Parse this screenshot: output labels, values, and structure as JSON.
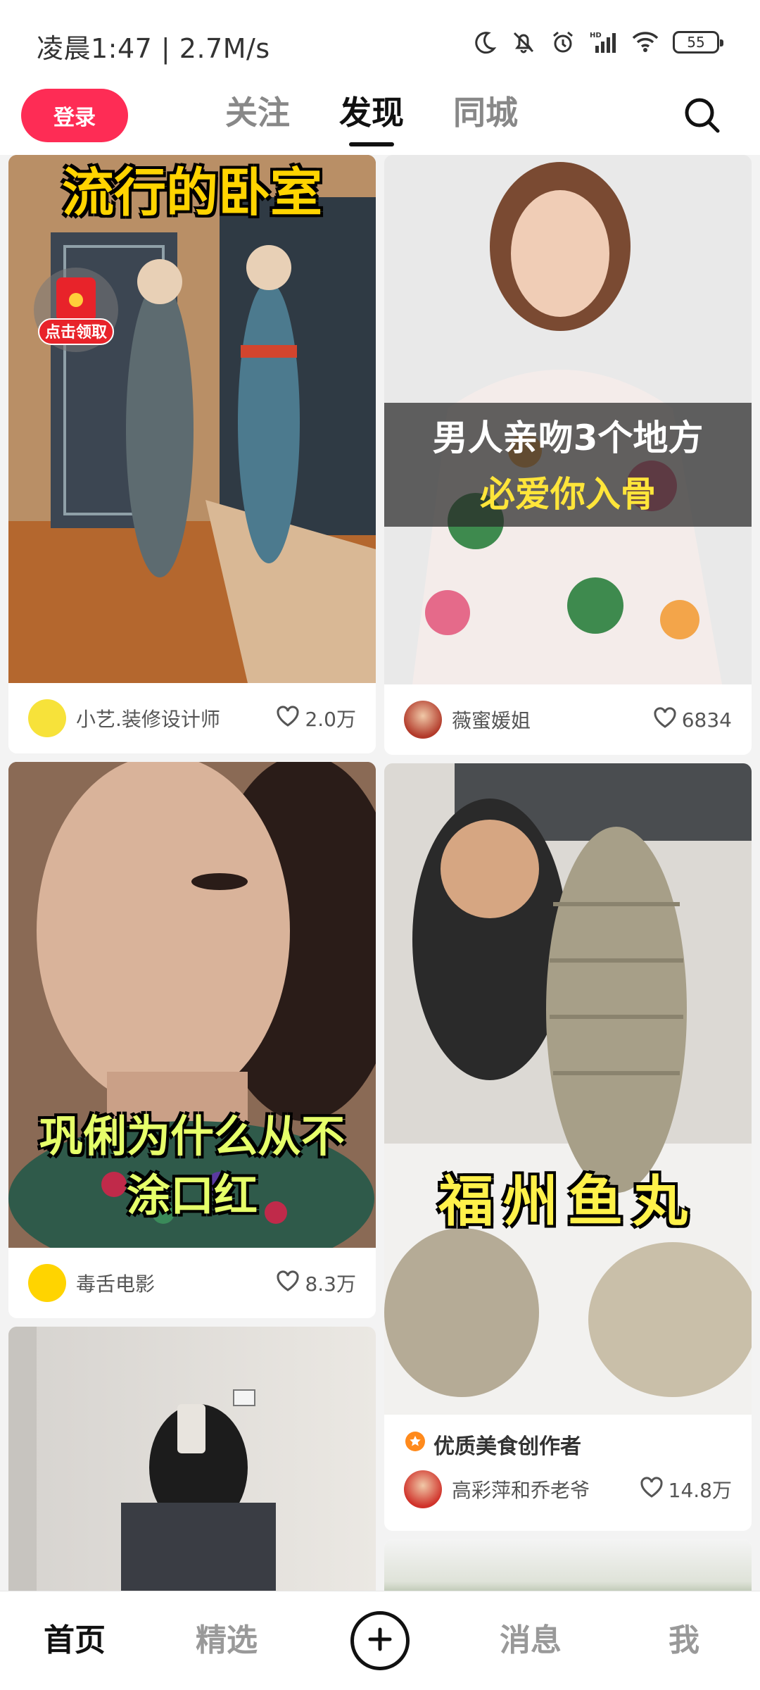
{
  "status": {
    "time": "凌晨1:47 | 2.7M/s",
    "battery": "55"
  },
  "topnav": {
    "login_label": "登录",
    "tabs": [
      {
        "label": "关注",
        "active": false
      },
      {
        "label": "发现",
        "active": true
      },
      {
        "label": "同城",
        "active": false
      }
    ]
  },
  "feed": {
    "cards": [
      {
        "overlay": "流行的卧室",
        "redpacket_label": "点击领取",
        "author": "小艺.装修设计师",
        "likes": "2.0万"
      },
      {
        "overlay_line1": "男人亲吻3个地方",
        "overlay_line2": "必爱你入骨",
        "author": "薇蜜媛姐",
        "likes": "6834"
      },
      {
        "overlay_line1": "巩俐为什么从不",
        "overlay_line2": "涂口红",
        "author": "毒舌电影",
        "likes": "8.3万"
      },
      {
        "overlay": "福州鱼丸",
        "badge": "优质美食创作者",
        "author": "高彩萍和乔老爷",
        "likes": "14.8万"
      },
      {},
      {}
    ]
  },
  "bottomnav": {
    "home": "首页",
    "featured": "精选",
    "messages": "消息",
    "me": "我"
  },
  "colors": {
    "accent": "#fe2c55",
    "active_text": "#111111",
    "inactive_text": "#888888"
  }
}
